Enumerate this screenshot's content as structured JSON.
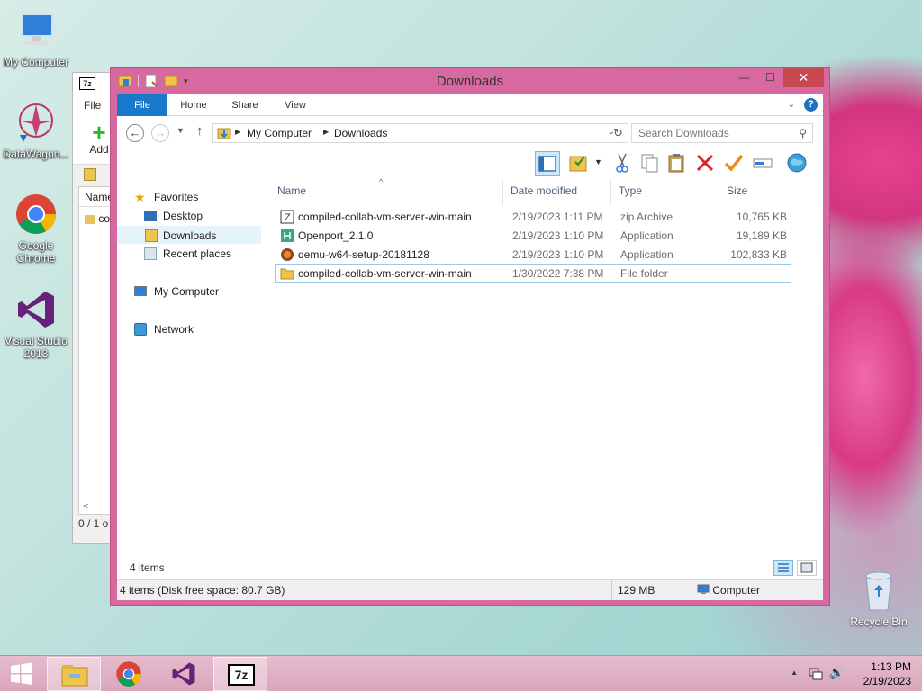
{
  "desktop": {
    "icons": [
      {
        "label": "My Computer"
      },
      {
        "label": "DataWagon..."
      },
      {
        "label": "Google Chrome"
      },
      {
        "label": "Visual Studio 2013"
      }
    ],
    "recycle_bin": "Recycle Bin"
  },
  "bg_window": {
    "app_icon": "7z",
    "menu_file": "File",
    "add_label": "Add",
    "column_name": "Name",
    "row_text": "co",
    "status": "0 / 1 o"
  },
  "window": {
    "title": "Downloads",
    "controls": {
      "minimize": "—",
      "maximize": "☐",
      "close": "✕"
    },
    "ribbon_tabs": [
      "File",
      "Home",
      "Share",
      "View"
    ],
    "address": {
      "crumbs": [
        "My Computer",
        "Downloads"
      ]
    },
    "search": {
      "placeholder": "Search Downloads"
    },
    "nav": {
      "favorites": "Favorites",
      "desktop": "Desktop",
      "downloads": "Downloads",
      "recent": "Recent places",
      "computer": "My Computer",
      "network": "Network"
    },
    "columns": {
      "name": "Name",
      "date": "Date modified",
      "type": "Type",
      "size": "Size"
    },
    "files": [
      {
        "name": "compiled-collab-vm-server-win-main",
        "date": "2/19/2023 1:11 PM",
        "type": "zip Archive",
        "size": "10,765 KB",
        "icon": "zip-icon"
      },
      {
        "name": "Openport_2.1.0",
        "date": "2/19/2023 1:10 PM",
        "type": "Application",
        "size": "19,189 KB",
        "icon": "app-icon"
      },
      {
        "name": "qemu-w64-setup-20181128",
        "date": "2/19/2023 1:10 PM",
        "type": "Application",
        "size": "102,833 KB",
        "icon": "qemu-icon"
      },
      {
        "name": "compiled-collab-vm-server-win-main",
        "date": "1/30/2022 7:38 PM",
        "type": "File folder",
        "size": "",
        "icon": "folder-icon"
      }
    ],
    "items_count": "4 items",
    "status": {
      "summary": "4 items (Disk free space: 80.7 GB)",
      "size": "129 MB",
      "location": "Computer"
    }
  },
  "taskbar": {
    "time": "1:13 PM",
    "date": "2/19/2023"
  },
  "colors": {
    "window_frame": "#d868a0",
    "ribbon_file": "#1979ca",
    "close_button": "#c7494f"
  }
}
